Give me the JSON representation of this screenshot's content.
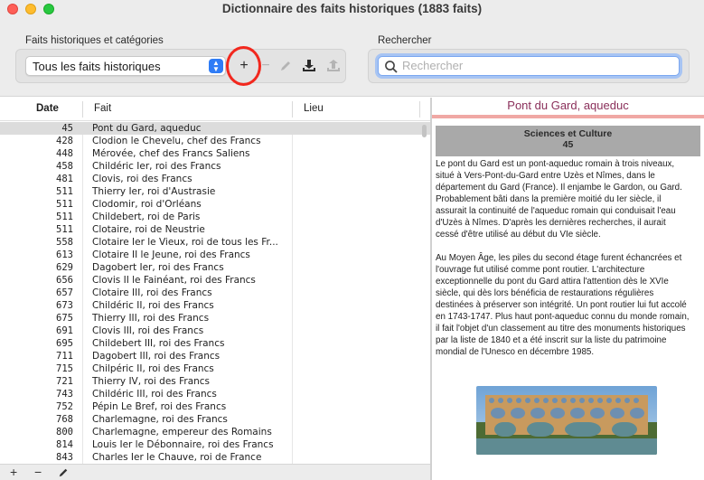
{
  "window": {
    "title": "Dictionnaire des faits historiques (1883 faits)"
  },
  "toolbar": {
    "group_label": "Faits historiques et catégories",
    "filter_value": "Tous les faits historiques",
    "add_label": "+",
    "remove_label": "−",
    "search_label": "Rechercher",
    "search_placeholder": "Rechercher"
  },
  "table": {
    "columns": [
      "Date",
      "Fait",
      "Lieu"
    ],
    "rows": [
      {
        "date": "45",
        "fait": "Pont du Gard, aqueduc"
      },
      {
        "date": "428",
        "fait": "Clodion le Chevelu, chef des Francs"
      },
      {
        "date": "448",
        "fait": "Mérovée, chef des Francs Saliens"
      },
      {
        "date": "458",
        "fait": "Childéric Ier, roi des Francs"
      },
      {
        "date": "481",
        "fait": "Clovis, roi des Francs"
      },
      {
        "date": "511",
        "fait": "Thierry Ier, roi d'Austrasie"
      },
      {
        "date": "511",
        "fait": "Clodomir, roi d'Orléans"
      },
      {
        "date": "511",
        "fait": "Childebert, roi de Paris"
      },
      {
        "date": "511",
        "fait": "Clotaire, roi de Neustrie"
      },
      {
        "date": "558",
        "fait": "Clotaire Ier le Vieux, roi de tous les Fr..."
      },
      {
        "date": "613",
        "fait": "Clotaire II le Jeune, roi des Francs"
      },
      {
        "date": "629",
        "fait": "Dagobert Ier, roi des Francs"
      },
      {
        "date": "656",
        "fait": "Clovis II le Fainéant, roi des Francs"
      },
      {
        "date": "657",
        "fait": "Clotaire III, roi des Francs"
      },
      {
        "date": "673",
        "fait": "Childéric II, roi des Francs"
      },
      {
        "date": "675",
        "fait": "Thierry III, roi des Francs"
      },
      {
        "date": "691",
        "fait": "Clovis III, roi des Francs"
      },
      {
        "date": "695",
        "fait": "Childebert III, roi des Francs"
      },
      {
        "date": "711",
        "fait": "Dagobert III, roi des Francs"
      },
      {
        "date": "715",
        "fait": "Chilpéric II, roi des Francs"
      },
      {
        "date": "721",
        "fait": "Thierry IV, roi des Francs"
      },
      {
        "date": "743",
        "fait": "Childéric III, roi des Francs"
      },
      {
        "date": "752",
        "fait": "Pépin Le Bref, roi des Francs"
      },
      {
        "date": "768",
        "fait": "Charlemagne, roi des Francs"
      },
      {
        "date": "800",
        "fait": "Charlemagne, empereur des Romains"
      },
      {
        "date": "814",
        "fait": "Louis Ier le Débonnaire, roi des Francs"
      },
      {
        "date": "843",
        "fait": "Charles Ier le Chauve, roi de France"
      }
    ]
  },
  "bottom_bar": {
    "add": "+",
    "remove": "−"
  },
  "detail": {
    "title": "Pont du Gard, aqueduc",
    "category": "Sciences et Culture",
    "date": "45",
    "paragraphs": [
      "Le pont du Gard est un pont-aqueduc romain à trois niveaux, situé à Vers-Pont-du-Gard entre Uzès et Nîmes, dans le département du Gard (France). Il enjambe le Gardon, ou Gard. Probablement bâti dans la première moitié du Ier siècle, il assurait la continuité de l'aqueduc romain qui conduisait l'eau d'Uzès à Nîmes. D'après les dernières recherches, il aurait cessé d'être utilisé au début du VIe siècle.",
      "Au Moyen Âge, les piles du second étage furent échancrées et l'ouvrage fut utilisé comme pont routier. L'architecture exceptionnelle du pont du Gard attira l'attention dès le XVIe siècle, qui dès lors bénéficia de restaurations régulières destinées à préserver son intégrité. Un pont routier lui fut accolé en 1743-1747. Plus haut pont-aqueduc connu du monde romain, il fait l'objet d'un classement au titre des monuments historiques par la liste de 1840 et a été inscrit sur la liste du patrimoine mondial de l'Unesco en décembre 1985."
    ]
  },
  "colors": {
    "title_accent": "#8a2f5a",
    "accent_bar": "#f0a8a4",
    "category_bg": "#a9a9a9",
    "selection": "#dcdcdc",
    "highlight_ring": "#f2281e",
    "focus_blue": "#2f7cf6"
  },
  "icons": {
    "edit": "pencil-icon",
    "import": "download-tray-icon",
    "export": "upload-tray-icon",
    "search": "magnifier-icon"
  }
}
